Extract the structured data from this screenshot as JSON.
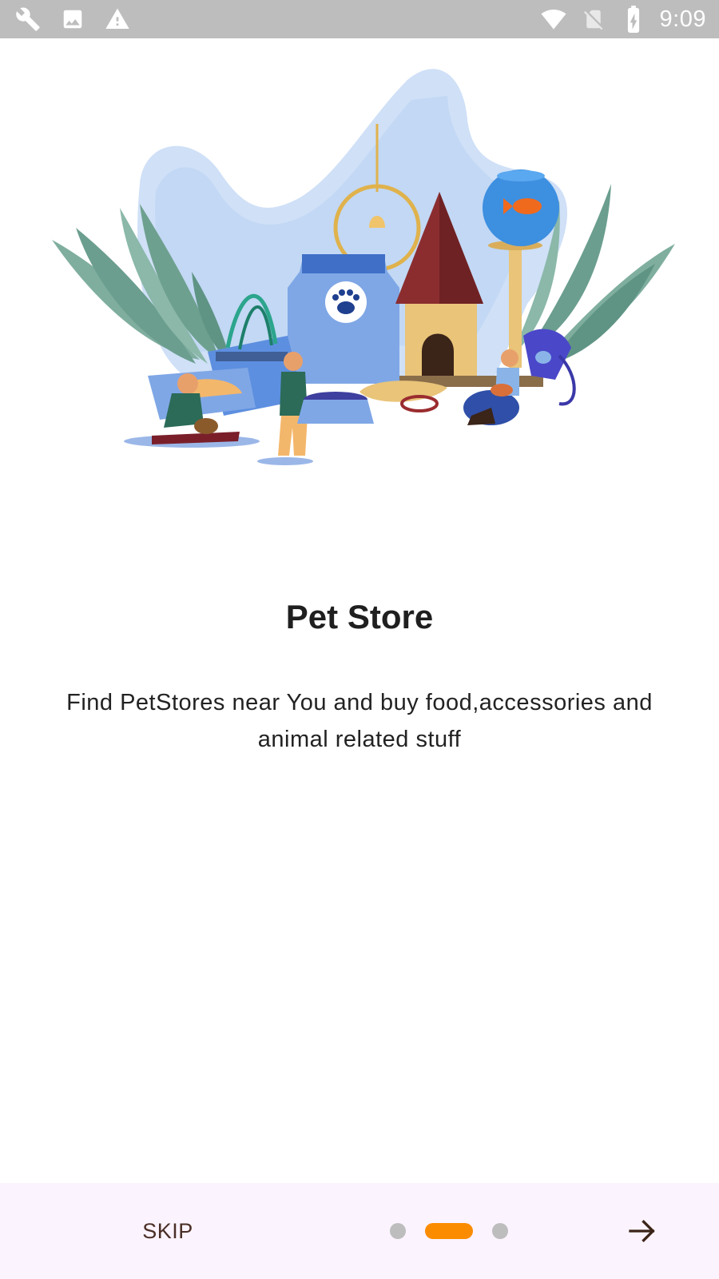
{
  "status_bar": {
    "time": "9:09",
    "left_icons": [
      "wrench-icon",
      "image-icon",
      "warning-icon"
    ],
    "right_icons": [
      "wifi-icon",
      "no-sim-icon",
      "battery-charging-icon"
    ]
  },
  "onboarding": {
    "title": "Pet Store",
    "description": "Find PetStores near You and buy food,accessories and animal related stuff"
  },
  "bottom_bar": {
    "skip_label": "SKIP",
    "page_count": 3,
    "current_page": 2,
    "next_icon": "arrow-right-icon"
  },
  "colors": {
    "status_bar": "#bdbdbd",
    "accent": "#fb8c00",
    "dot_inactive": "#bdbdbd",
    "bottom_bar": "#fbf3fd",
    "skip_text": "#4a2f26"
  }
}
